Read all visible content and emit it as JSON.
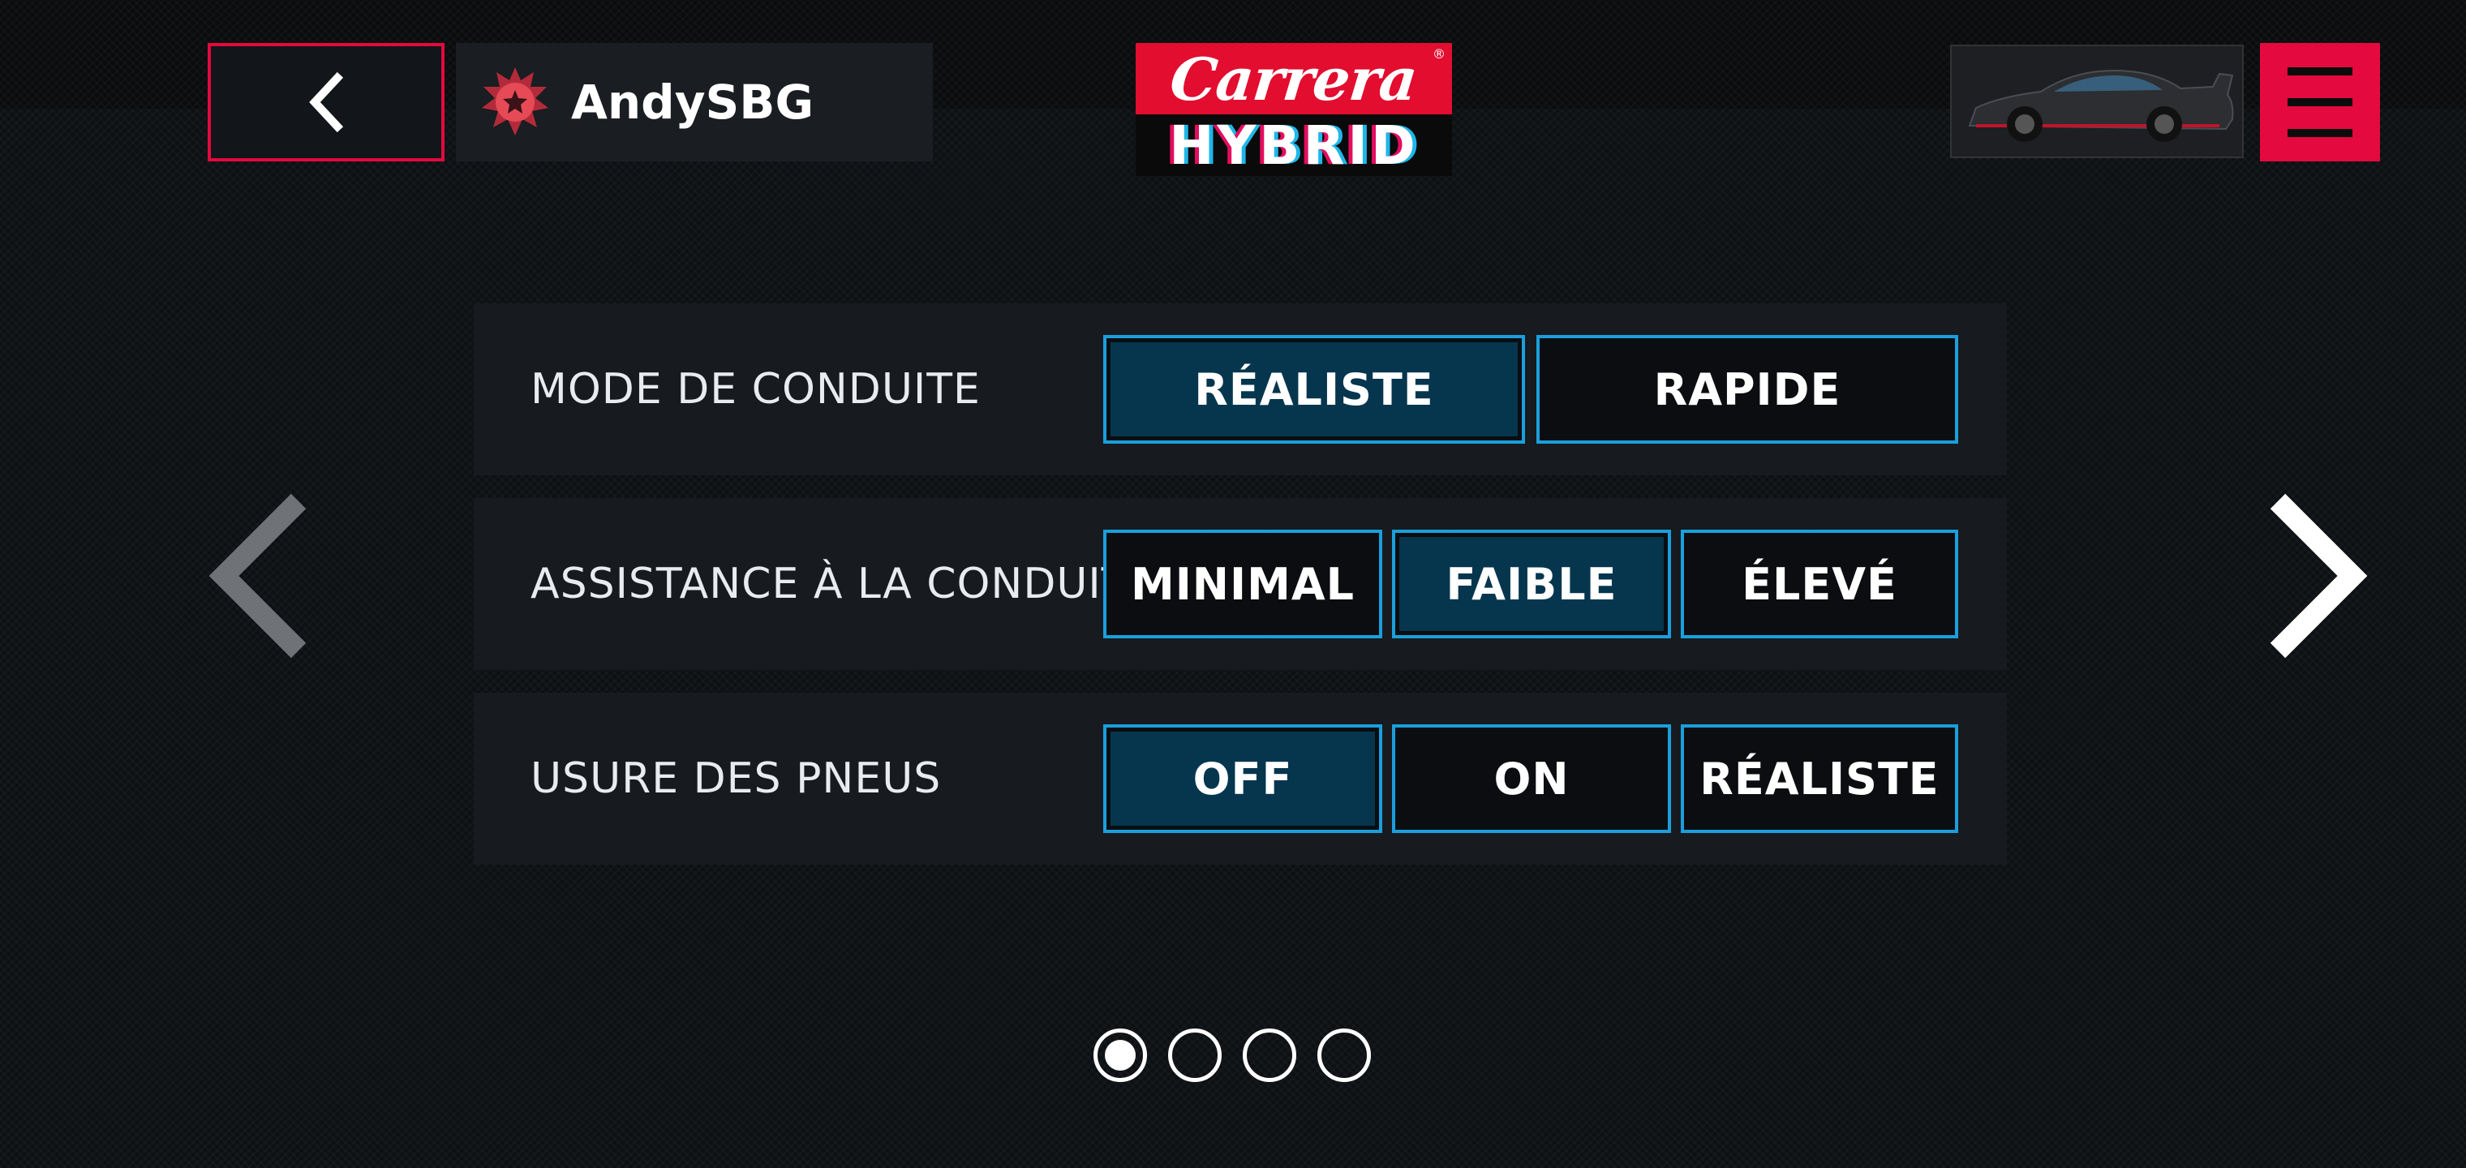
{
  "header": {
    "username": "AndySBG",
    "logo_top": "Carrera",
    "logo_reg": "®",
    "logo_bottom": "HYBRID",
    "icons": {
      "back": "chevron-left-icon",
      "rank": "star-badge-icon",
      "car": "car-thumbnail",
      "menu": "hamburger-menu-icon"
    }
  },
  "settings": [
    {
      "label": "MODE DE CONDUITE",
      "options": [
        "RÉALISTE",
        "RAPIDE"
      ],
      "selected": "RÉALISTE"
    },
    {
      "label": "ASSISTANCE À LA CONDUITE",
      "options": [
        "MINIMAL",
        "FAIBLE",
        "ÉLEVÉ"
      ],
      "selected": "FAIBLE"
    },
    {
      "label": "USURE DES PNEUS",
      "options": [
        "OFF",
        "ON",
        "RÉALISTE"
      ],
      "selected": "OFF"
    }
  ],
  "pagination": {
    "total_pages": 4,
    "current_page": 1
  },
  "colors": {
    "accent_red": "#e4093e",
    "option_border": "#1a9fdd",
    "option_selected_fill": "#05364e"
  }
}
